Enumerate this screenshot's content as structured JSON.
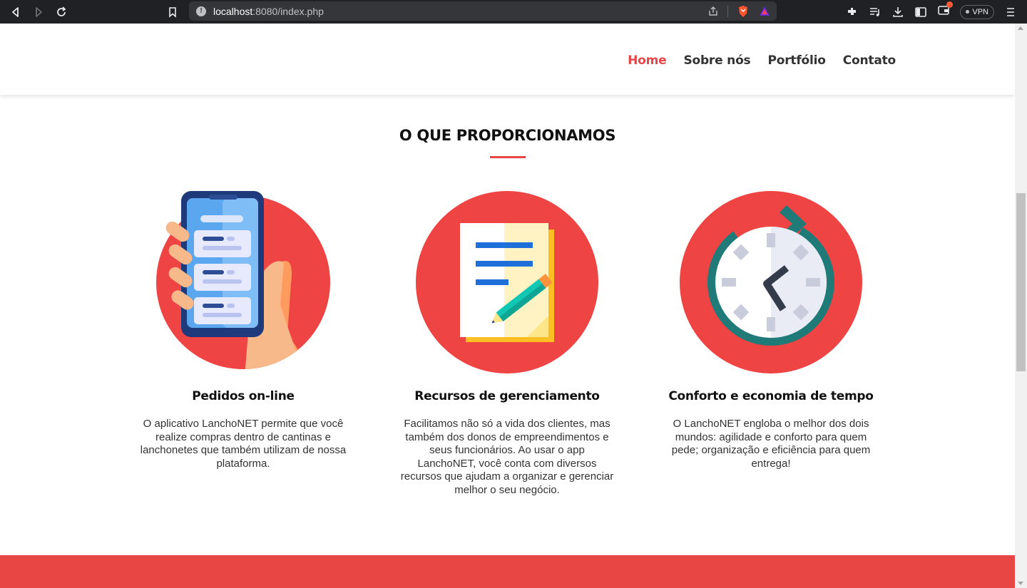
{
  "browser": {
    "url_host": "localhost",
    "url_rest": ":8080/index.php",
    "vpn_label": "VPN"
  },
  "nav": {
    "items": [
      {
        "label": "Home",
        "active": true
      },
      {
        "label": "Sobre nós",
        "active": false
      },
      {
        "label": "Portfólio",
        "active": false
      },
      {
        "label": "Contato",
        "active": false
      }
    ]
  },
  "section": {
    "title": "O QUE PROPORCIONAMOS"
  },
  "features": [
    {
      "icon": "phone-hand-icon",
      "title": "Pedidos on-line",
      "text": "O aplicativo LanchoNET permite que você realize compras dentro de cantinas e lanchonetes que também utilizam de nossa plataforma."
    },
    {
      "icon": "document-pencil-icon",
      "title": "Recursos de gerenciamento",
      "text": "Facilitamos não só a vida dos clientes, mas também dos donos de empreendimentos e seus funcionários. Ao usar o app LanchoNET, você conta com diversos recursos que ajudam a organizar e gerenciar melhor o seu negócio."
    },
    {
      "icon": "clock-refresh-icon",
      "title": "Conforto e economia de tempo",
      "text": "O LanchoNET engloba o melhor dos dois mundos: agilidade e conforto para quem pede; organização e eficiência para quem entrega!"
    }
  ],
  "colors": {
    "accent": "#e84545",
    "circle": "#ef4444"
  }
}
